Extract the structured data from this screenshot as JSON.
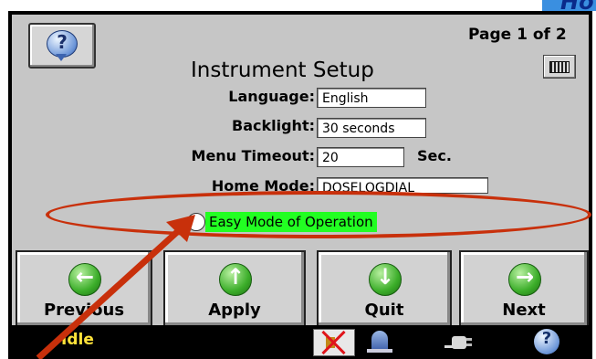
{
  "corner_fragment_text": "Ho",
  "header": {
    "page_indicator": "Page 1 of 2",
    "title": "Instrument Setup",
    "help_icon": "help-bubble-icon",
    "keyboard_icon": "keyboard-icon"
  },
  "fields": {
    "language": {
      "label": "Language:",
      "value": "English"
    },
    "backlight": {
      "label": "Backlight:",
      "value": "30 seconds"
    },
    "menu_timeout": {
      "label": "Menu Timeout:",
      "value": "20",
      "unit": "Sec."
    },
    "home_mode": {
      "label": "Home Mode:",
      "value": "DOSELOGDIAL"
    }
  },
  "easy_mode": {
    "label": "Easy Mode of Operation",
    "checked": false,
    "highlight_color": "#22ff22",
    "annotation_color": "#c8300b"
  },
  "nav": {
    "previous": {
      "label": "Previous",
      "icon": "arrow-left-icon"
    },
    "apply": {
      "label": "Apply",
      "icon": "arrow-up-icon"
    },
    "quit": {
      "label": "Quit",
      "icon": "arrow-down-icon"
    },
    "next": {
      "label": "Next",
      "icon": "arrow-right-icon"
    }
  },
  "status_bar": {
    "status": "Idle",
    "icons": [
      "muted-speaker-icon",
      "bell-icon",
      "power-plug-icon",
      "help-icon"
    ]
  },
  "colors": {
    "screen_bg": "#c6c6c6",
    "status_text": "#ffe23a",
    "nav_icon_green": "#3cae2a"
  }
}
